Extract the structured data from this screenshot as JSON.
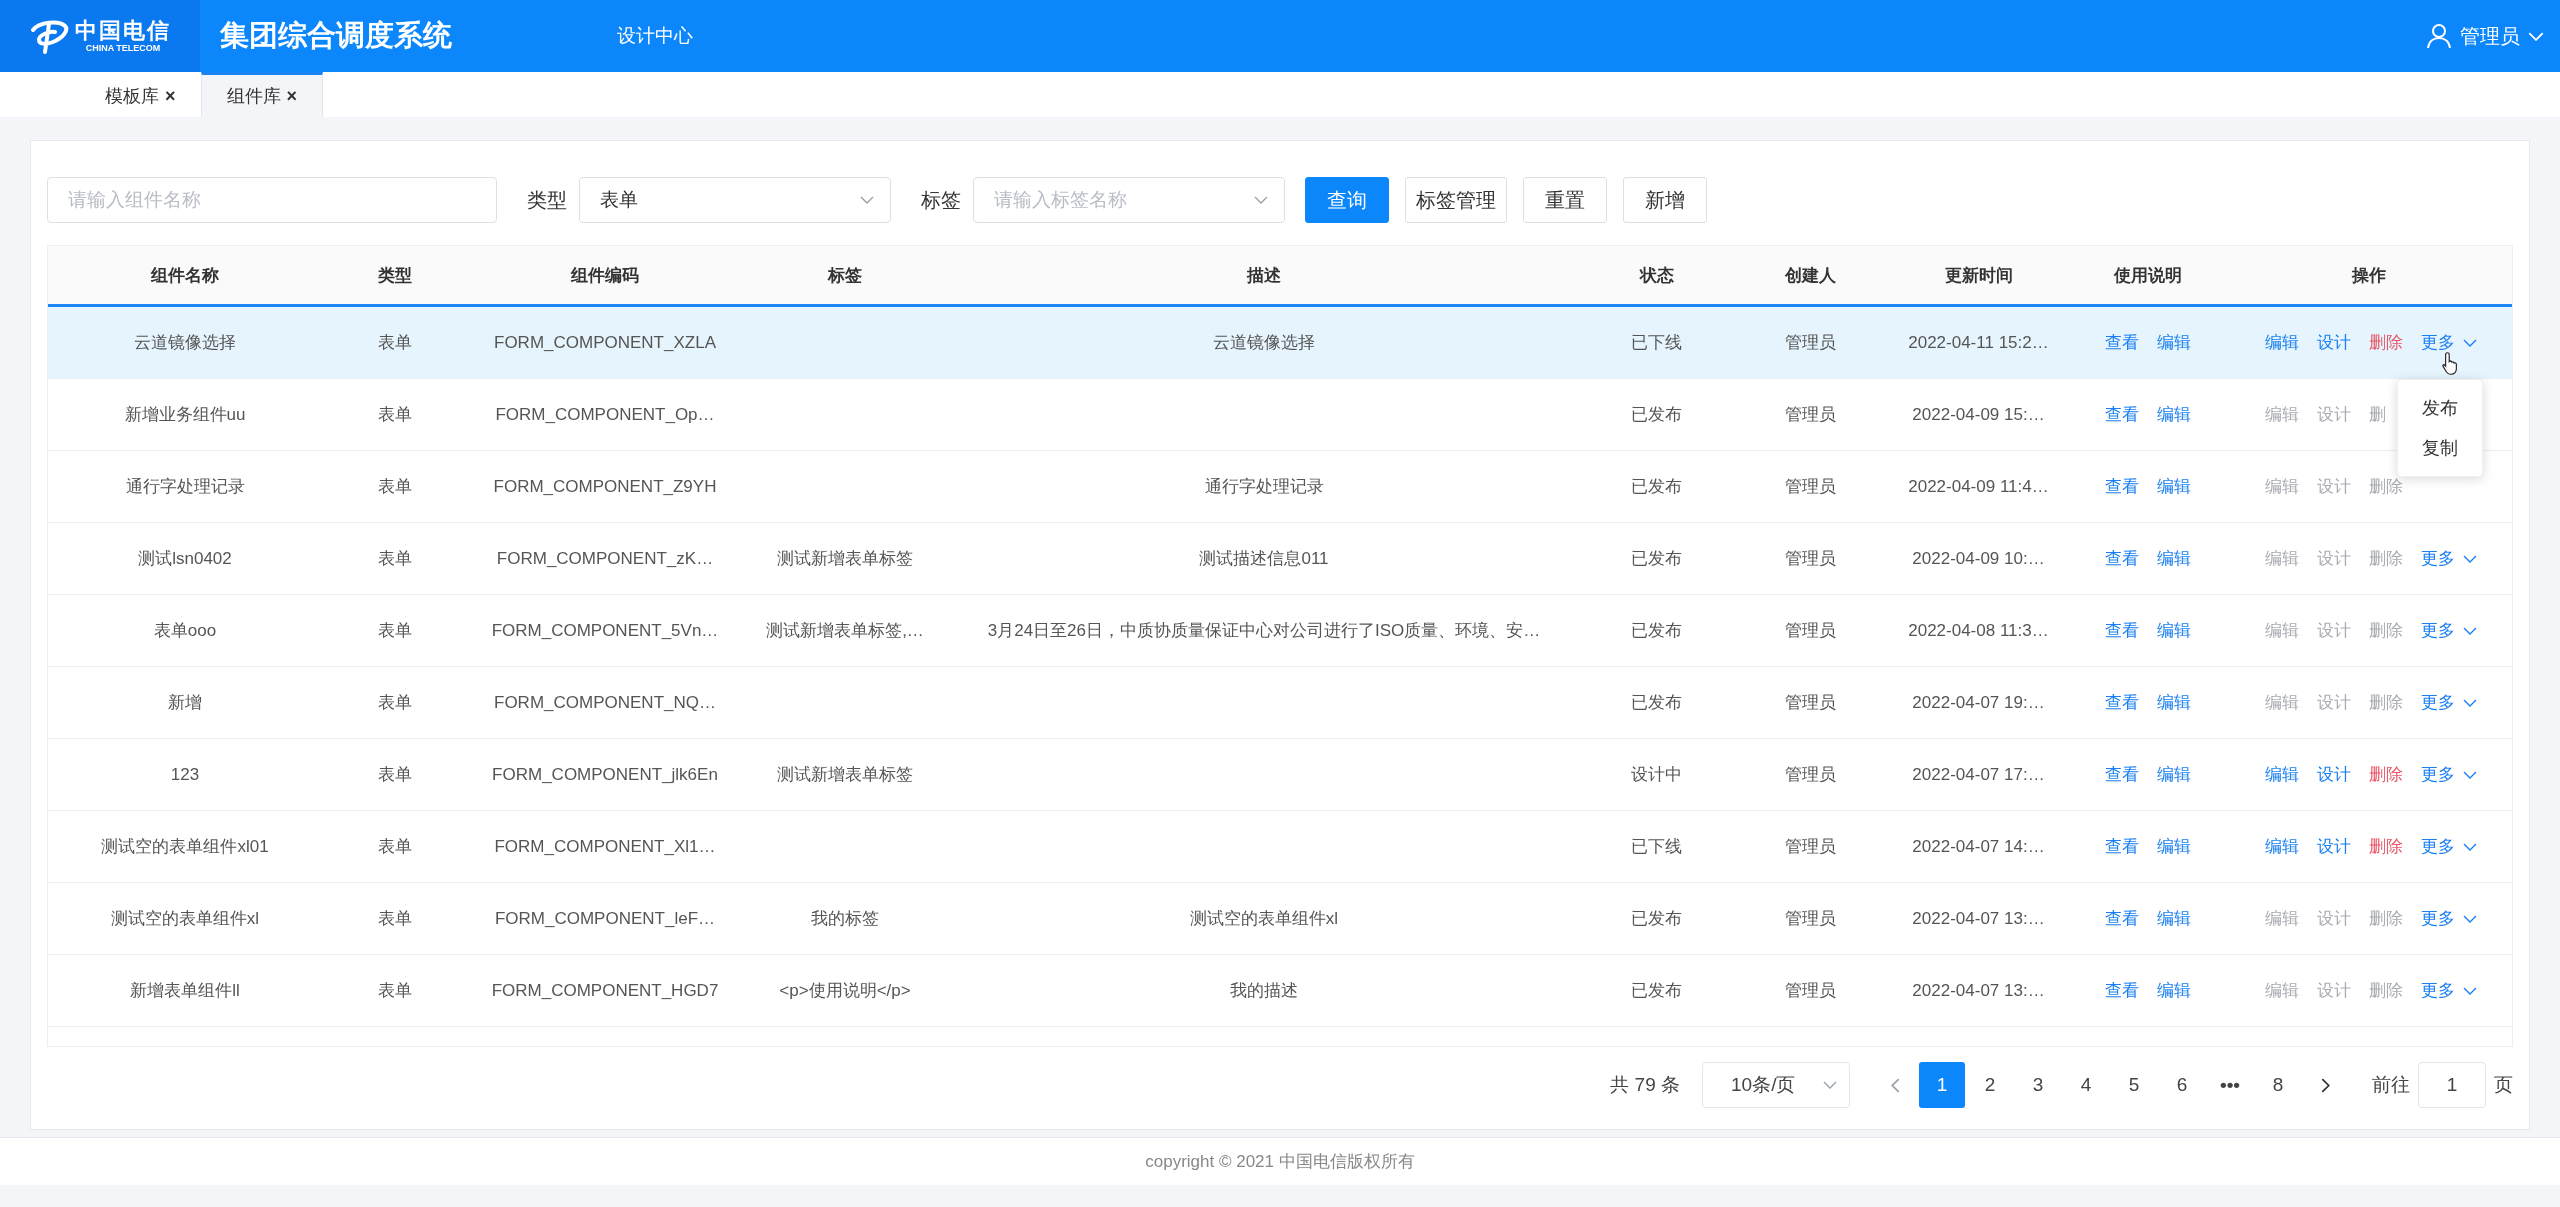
{
  "header": {
    "logo": {
      "name": "中国电信",
      "subtitle": "CHINA TELECOM"
    },
    "title": "集团综合调度系统",
    "nav": [
      "设计中心"
    ],
    "user": "管理员"
  },
  "tabs": [
    {
      "label": "模板库",
      "close": "×",
      "selected": false
    },
    {
      "label": "组件库",
      "close": "×",
      "selected": true
    }
  ],
  "filters": {
    "name_field": {
      "placeholder": "请输入组件名称"
    },
    "type": {
      "label": "类型",
      "value": "表单"
    },
    "tag": {
      "label": "标签",
      "placeholder": "请输入标签名称"
    }
  },
  "buttons": [
    {
      "label": "查询",
      "kind": "primary"
    },
    {
      "label": "标签管理",
      "kind": "default"
    },
    {
      "label": "重置",
      "kind": "default"
    },
    {
      "label": "新增",
      "kind": "default"
    }
  ],
  "table": {
    "columns": [
      "组件名称",
      "类型",
      "组件编码",
      "标签",
      "描述",
      "状态",
      "创建人",
      "更新时间",
      "使用说明",
      "操作"
    ],
    "rows": [
      {
        "selected": true,
        "cells": {
          "name": "云道镜像选择",
          "type": "表单",
          "code": "FORM_COMPONENT_XZLA",
          "description": "云道镜像选择",
          "status": "已下线",
          "creator": "管理员",
          "updated": "2022-04-11 15:2…"
        },
        "usage": [
          "查看",
          "编辑"
        ],
        "actions": [
          {
            "label": "编辑",
            "kind": "edit",
            "disabled": false
          },
          {
            "label": "设计",
            "kind": "design",
            "disabled": false
          },
          {
            "label": "删除",
            "kind": "delete",
            "disabled": false
          }
        ],
        "more": "更多",
        "menu": [
          "发布",
          "复制"
        ]
      },
      {
        "selected": false,
        "cells": {
          "name": "新增业务组件uu",
          "type": "表单",
          "code": "FORM_COMPONENT_Op…",
          "status": "已发布",
          "creator": "管理员",
          "updated": "2022-04-09 15:…"
        },
        "usage": [
          "查看",
          "编辑"
        ],
        "actions": [
          {
            "label": "编辑",
            "kind": "edit",
            "disabled": true
          },
          {
            "label": "设计",
            "kind": "design",
            "disabled": true
          },
          {
            "label": "删",
            "kind": "delete",
            "disabled": true
          }
        ]
      },
      {
        "selected": false,
        "cells": {
          "name": "通行字处理记录",
          "type": "表单",
          "code": "FORM_COMPONENT_Z9YH",
          "description": "通行字处理记录",
          "status": "已发布",
          "creator": "管理员",
          "updated": "2022-04-09 11:4…"
        },
        "usage": [
          "查看",
          "编辑"
        ],
        "actions": [
          {
            "label": "编辑",
            "kind": "edit",
            "disabled": true
          },
          {
            "label": "设计",
            "kind": "design",
            "disabled": true
          },
          {
            "label": "删除",
            "kind": "delete",
            "disabled": true
          }
        ]
      },
      {
        "selected": false,
        "cells": {
          "name": "测试lsn0402",
          "type": "表单",
          "code": "FORM_COMPONENT_zK…",
          "tags": "测试新增表单标签",
          "description": "测试描述信息011",
          "status": "已发布",
          "creator": "管理员",
          "updated": "2022-04-09 10:…"
        },
        "usage": [
          "查看",
          "编辑"
        ],
        "actions": [
          {
            "label": "编辑",
            "kind": "edit",
            "disabled": true
          },
          {
            "label": "设计",
            "kind": "design",
            "disabled": true
          },
          {
            "label": "删除",
            "kind": "delete",
            "disabled": true
          }
        ],
        "more": "更多"
      },
      {
        "selected": false,
        "cells": {
          "name": "表单ooo",
          "type": "表单",
          "code": "FORM_COMPONENT_5Vn…",
          "tags": "测试新增表单标签,…",
          "description": "3月24日至26日，中质协质量保证中心对公司进行了ISO质量、环境、安…",
          "status": "已发布",
          "creator": "管理员",
          "updated": "2022-04-08 11:3…"
        },
        "usage": [
          "查看",
          "编辑"
        ],
        "actions": [
          {
            "label": "编辑",
            "kind": "edit",
            "disabled": true
          },
          {
            "label": "设计",
            "kind": "design",
            "disabled": true
          },
          {
            "label": "删除",
            "kind": "delete",
            "disabled": true
          }
        ],
        "more": "更多"
      },
      {
        "selected": false,
        "cells": {
          "name": "新增",
          "type": "表单",
          "code": "FORM_COMPONENT_NQ…",
          "status": "已发布",
          "creator": "管理员",
          "updated": "2022-04-07 19:…"
        },
        "usage": [
          "查看",
          "编辑"
        ],
        "actions": [
          {
            "label": "编辑",
            "kind": "edit",
            "disabled": true
          },
          {
            "label": "设计",
            "kind": "design",
            "disabled": true
          },
          {
            "label": "删除",
            "kind": "delete",
            "disabled": true
          }
        ],
        "more": "更多"
      },
      {
        "selected": false,
        "cells": {
          "name": "123",
          "type": "表单",
          "code": "FORM_COMPONENT_jlk6En",
          "tags": "测试新增表单标签",
          "status": "设计中",
          "creator": "管理员",
          "updated": "2022-04-07 17:…"
        },
        "usage": [
          "查看",
          "编辑"
        ],
        "actions": [
          {
            "label": "编辑",
            "kind": "edit",
            "disabled": false
          },
          {
            "label": "设计",
            "kind": "design",
            "disabled": false
          },
          {
            "label": "删除",
            "kind": "delete",
            "disabled": false
          }
        ],
        "more": "更多"
      },
      {
        "selected": false,
        "cells": {
          "name": "测试空的表单组件xl01",
          "type": "表单",
          "code": "FORM_COMPONENT_Xl1…",
          "status": "已下线",
          "creator": "管理员",
          "updated": "2022-04-07 14:…"
        },
        "usage": [
          "查看",
          "编辑"
        ],
        "actions": [
          {
            "label": "编辑",
            "kind": "edit",
            "disabled": false
          },
          {
            "label": "设计",
            "kind": "design",
            "disabled": false
          },
          {
            "label": "删除",
            "kind": "delete",
            "disabled": false
          }
        ],
        "more": "更多"
      },
      {
        "selected": false,
        "cells": {
          "name": "测试空的表单组件xl",
          "type": "表单",
          "code": "FORM_COMPONENT_leF…",
          "tags": "我的标签",
          "description": "测试空的表单组件xl",
          "status": "已发布",
          "creator": "管理员",
          "updated": "2022-04-07 13:…"
        },
        "usage": [
          "查看",
          "编辑"
        ],
        "actions": [
          {
            "label": "编辑",
            "kind": "edit",
            "disabled": true
          },
          {
            "label": "设计",
            "kind": "design",
            "disabled": true
          },
          {
            "label": "删除",
            "kind": "delete",
            "disabled": true
          }
        ],
        "more": "更多"
      },
      {
        "selected": false,
        "cells": {
          "name": "新增表单组件ll",
          "type": "表单",
          "code": "FORM_COMPONENT_HGD7",
          "tags": "<p>使用说明</p>",
          "description": "我的描述",
          "status": "已发布",
          "creator": "管理员",
          "updated": "2022-04-07 13:…"
        },
        "usage": [
          "查看",
          "编辑"
        ],
        "actions": [
          {
            "label": "编辑",
            "kind": "edit",
            "disabled": true
          },
          {
            "label": "设计",
            "kind": "design",
            "disabled": true
          },
          {
            "label": "删除",
            "kind": "delete",
            "disabled": true
          }
        ],
        "more": "更多"
      }
    ]
  },
  "pagination": {
    "total": "共 79 条",
    "page_size": "10条/页",
    "prev": {
      "disabled": true
    },
    "next": {
      "disabled": false
    },
    "pages": [
      {
        "label": "1",
        "kind": "page",
        "selected": true
      },
      {
        "label": "2",
        "kind": "page",
        "selected": false
      },
      {
        "label": "3",
        "kind": "page",
        "selected": false
      },
      {
        "label": "4",
        "kind": "page",
        "selected": false
      },
      {
        "label": "5",
        "kind": "page",
        "selected": false
      },
      {
        "label": "6",
        "kind": "page",
        "selected": false
      },
      {
        "label": "•••",
        "kind": "ellipsis",
        "selected": false
      },
      {
        "label": "8",
        "kind": "page",
        "selected": false
      }
    ],
    "jump": {
      "label": "前往",
      "value": "1",
      "suffix": "页"
    }
  },
  "footer": "copyright © 2021 中国电信版权所有"
}
